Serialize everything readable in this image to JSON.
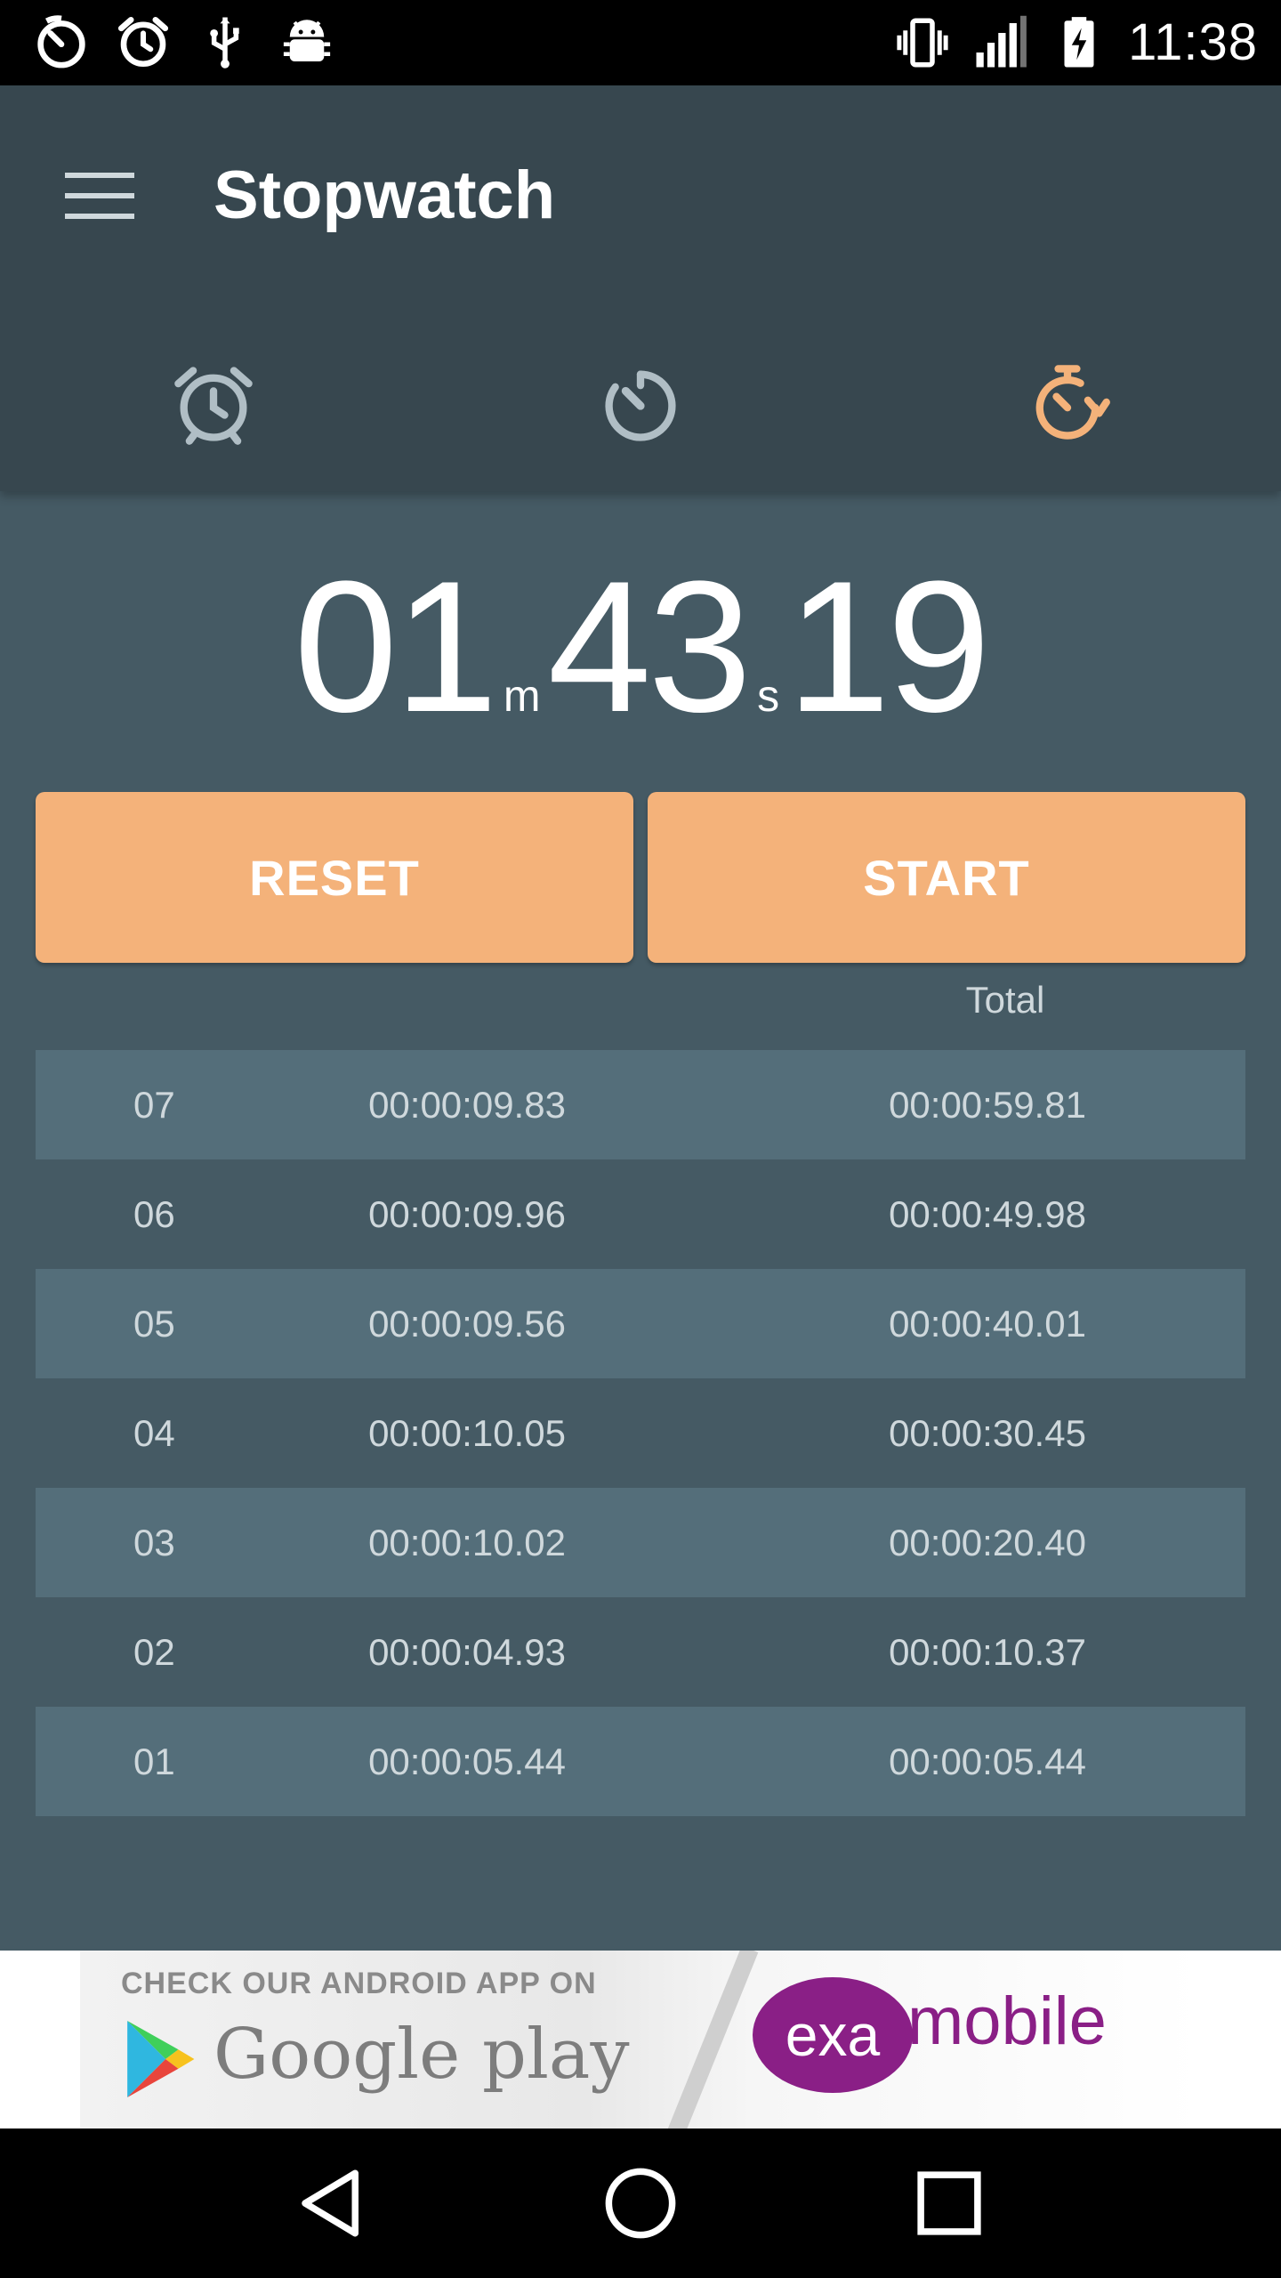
{
  "status_bar": {
    "time": "11:38",
    "left_icons": [
      "timer-icon",
      "alarm-icon",
      "usb-icon",
      "android-debug-icon"
    ],
    "right_icons": [
      "vibrate-icon",
      "signal-icon",
      "battery-charging-icon"
    ]
  },
  "app_bar": {
    "title": "Stopwatch",
    "menu_icon": "hamburger-menu-icon",
    "tabs": [
      {
        "icon": "alarm-clock-icon",
        "active": false
      },
      {
        "icon": "timer-icon",
        "active": false
      },
      {
        "icon": "stopwatch-icon",
        "active": true
      }
    ],
    "active_color": "#f4b27a",
    "inactive_color": "#b0bec5"
  },
  "display": {
    "minutes": "01",
    "minutes_unit": "m",
    "seconds": "43",
    "seconds_unit": "s",
    "hundredths": "19"
  },
  "buttons": {
    "reset_label": "RESET",
    "start_label": "START"
  },
  "laps_header": {
    "total_label": "Total"
  },
  "laps": [
    {
      "num": "07",
      "lap": "00:00:09.83",
      "total": "00:00:59.81"
    },
    {
      "num": "06",
      "lap": "00:00:09.96",
      "total": "00:00:49.98"
    },
    {
      "num": "05",
      "lap": "00:00:09.56",
      "total": "00:00:40.01"
    },
    {
      "num": "04",
      "lap": "00:00:10.05",
      "total": "00:00:30.45"
    },
    {
      "num": "03",
      "lap": "00:00:10.02",
      "total": "00:00:20.40"
    },
    {
      "num": "02",
      "lap": "00:00:04.93",
      "total": "00:00:10.37"
    },
    {
      "num": "01",
      "lap": "00:00:05.44",
      "total": "00:00:05.44"
    }
  ],
  "ad": {
    "check_text": "CHECK OUR ANDROID APP ON",
    "store_text": "Google play",
    "brand_exa": "exa",
    "brand_mobile": "mobile"
  },
  "nav_bar": {
    "icons": [
      "back-icon",
      "home-icon",
      "recents-icon"
    ]
  }
}
